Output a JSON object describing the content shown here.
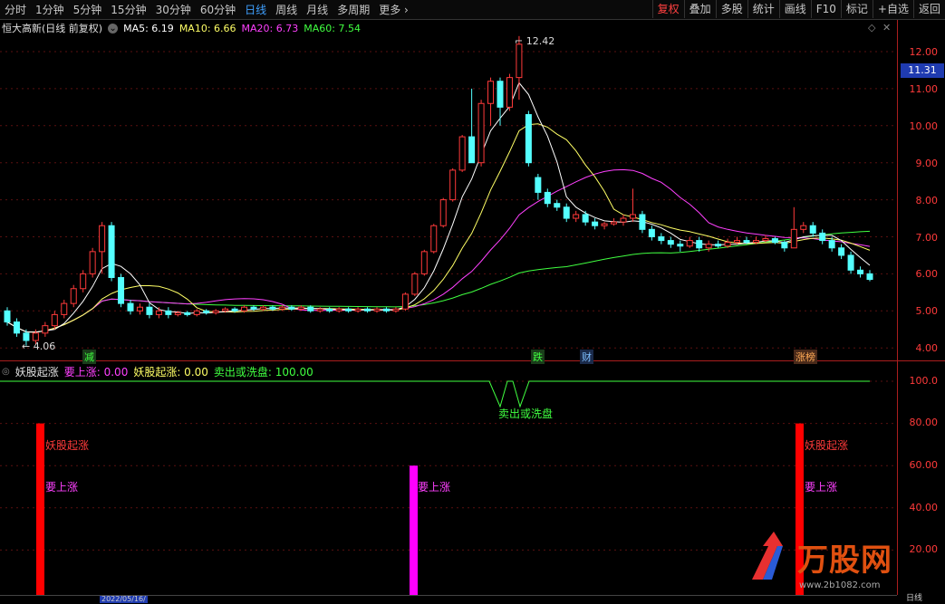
{
  "toolbar": {
    "tabs": [
      "分时",
      "1分钟",
      "5分钟",
      "15分钟",
      "30分钟",
      "60分钟",
      "日线",
      "周线",
      "月线",
      "多周期",
      "更多"
    ],
    "active_tab": "日线",
    "more_chevron": "›",
    "right_buttons": [
      "复权",
      "叠加",
      "多股",
      "统计",
      "画线",
      "F10",
      "标记",
      "+自选",
      "返回"
    ]
  },
  "main_legend": {
    "title": "恒大高新(日线 前复权)",
    "ma5": "MA5: 6.19",
    "ma10": "MA10: 6.66",
    "ma20": "MA20: 6.73",
    "ma60": "MA60: 7.54"
  },
  "price_axis": {
    "ticks": [
      "12.00",
      "11.00",
      "10.00",
      "9.00",
      "8.00",
      "7.00",
      "6.00",
      "5.00",
      "4.00"
    ],
    "current_price": "11.31"
  },
  "annotations": {
    "high": "12.42",
    "low": "4.06"
  },
  "signals": [
    "减",
    "跌",
    "财",
    "涨榜"
  ],
  "indicator_legend": {
    "name": "妖股起涨",
    "v1": "要上涨: 0.00",
    "v2": "妖股起涨: 0.00",
    "v3": "卖出或洗盘: 100.00"
  },
  "indicator_axis": {
    "ticks": [
      "100.0",
      "80.00",
      "60.00",
      "40.00",
      "20.00"
    ]
  },
  "indicator_labels": {
    "sell": "卖出或洗盘",
    "yao": "妖股起涨",
    "rise": "要上涨"
  },
  "bottom": {
    "date": "2022/05/16/",
    "period": "日线"
  },
  "watermark": {
    "brand": "万股网",
    "url": "www.2b1082.com"
  },
  "colors": {
    "up": "#ff3a3a",
    "down": "#54ffff",
    "ma5": "#ffffff",
    "ma10": "#ffff66",
    "ma20": "#ff40ff",
    "ma60": "#40ff40",
    "bar_red": "#ff0000",
    "bar_magenta": "#ff00ff"
  }
}
